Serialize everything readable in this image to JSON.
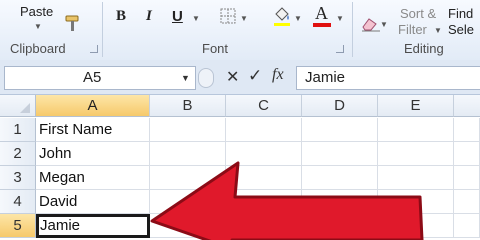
{
  "ribbon": {
    "clipboard": {
      "paste_label": "Paste",
      "group_label": "Clipboard"
    },
    "font": {
      "bold": "B",
      "italic": "I",
      "underline": "U",
      "font_color_glyph": "A",
      "group_label": "Font"
    },
    "editing": {
      "sort_filter_line1": "Sort &",
      "sort_filter_line2": "Filter",
      "find_line1": "Find",
      "find_line2": "Sele",
      "group_label": "Editing"
    }
  },
  "formula_bar": {
    "name_box": "A5",
    "cancel": "✕",
    "enter": "✓",
    "fx": "fx",
    "value": "Jamie"
  },
  "columns": [
    "A",
    "B",
    "C",
    "D",
    "E"
  ],
  "rows": [
    {
      "num": "1",
      "a": "First Name"
    },
    {
      "num": "2",
      "a": "John"
    },
    {
      "num": "3",
      "a": "Megan"
    },
    {
      "num": "4",
      "a": "David"
    },
    {
      "num": "5",
      "a": "Jamie"
    }
  ],
  "selection": {
    "active_cell": "A5"
  },
  "colors": {
    "arrow": "#e0192b",
    "arrow_outline": "#8c0b16",
    "font_color_bar": "#e01010",
    "ribbon_bg": "#e2ebf7"
  },
  "icons": [
    "paste-icon",
    "format-painter-icon",
    "borders-icon",
    "fill-color-icon",
    "font-color-icon",
    "clear-icon",
    "dialog-launcher-icon",
    "cancel-icon",
    "enter-icon",
    "fx-icon",
    "dropdown-icon"
  ]
}
